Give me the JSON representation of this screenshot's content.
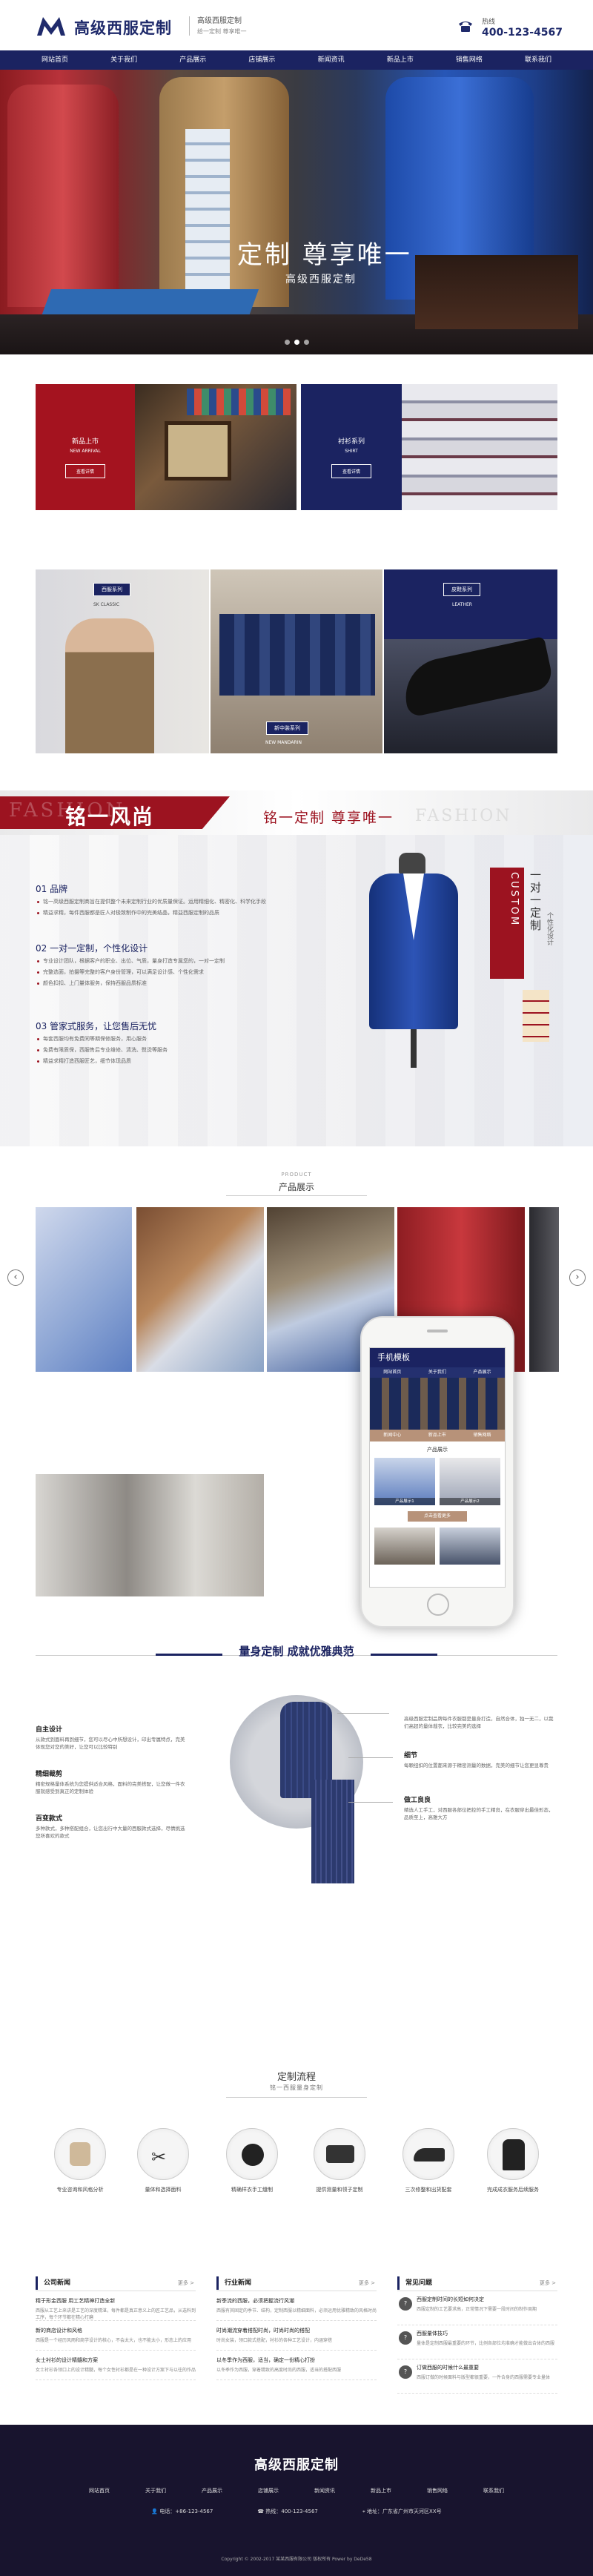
{
  "header": {
    "logo_title": "高级西服定制",
    "tagline_1": "高级西服定制",
    "tagline_2": "给一定制 尊享唯一",
    "hotline_label": "热线",
    "hotline": "400-123-4567"
  },
  "nav": [
    "网站首页",
    "关于我们",
    "产品展示",
    "店铺展示",
    "新闻资讯",
    "新品上市",
    "销售网络",
    "联系我们"
  ],
  "banner": {
    "caption": "定制  尊享唯一",
    "sub": "高级西服定制"
  },
  "categories": {
    "new": {
      "cn": "新品上市",
      "en": "NEW ARRIVAL",
      "btn": "查看详情"
    },
    "shirt": {
      "cn": "衬衫系列",
      "en": "SHIRT",
      "btn": "查看详情"
    },
    "classic": {
      "cn": "西服系列",
      "en": "SK CLASSIC"
    },
    "chinese": {
      "cn": "新中装系列",
      "en": "NEW MANDARIN"
    },
    "leather": {
      "cn": "皮鞋系列",
      "en": "LEATHER"
    }
  },
  "fashion": {
    "bg_en": "FASHION",
    "title": "铭一风尚",
    "slogan": "铭一定制  尊享唯一",
    "bg_en2": "FASHION",
    "points": [
      {
        "h": "01 品牌",
        "lines": [
          "铭一高级西服定制商旨在提供整个未来定制行业的优质量保证。运用精细化、精密化、科学化手段",
          "精益求精，每件西服都是匠人对极致制作中的完美结晶，精益西服定制的品质"
        ]
      },
      {
        "h": "02 一对一定制，个性化设计",
        "lines": [
          "专业设计团队，根据客户的职业、出位、气质，量身打造专属您的，一对一定制",
          "完整选面，拍摄等完整的客户身份管理，可以满足设计感、个性化需求",
          "颜色扣扣、上门量体服务，保持西服品质标准"
        ]
      },
      {
        "h": "03 管家式服务，让您售后无忧",
        "lines": [
          "每套西服均有免费同等期保修服务，用心服务",
          "免费有限质保，西服售后专业维修、清洗、熨烫等服务",
          "精益求精打造西服匠艺，细节体现品质"
        ]
      }
    ],
    "sign_cn": "一对一定制",
    "sign_en": "CUSTOM",
    "sign_side": "个性化设计"
  },
  "product": {
    "en": "PRODUCT",
    "cn": "产品展示",
    "prev": "‹",
    "next": "›"
  },
  "mobile": {
    "title": "手机模板",
    "nav": [
      "网站首页",
      "关于我们",
      "产品展示",
      "新闻中心",
      "新品上市",
      "销售网络"
    ],
    "tab": "产品展示",
    "items": [
      "产品展示1",
      "产品展示2"
    ],
    "more": "点击查看更多"
  },
  "design": {
    "title": "量身定制 成就优雅典范",
    "left": [
      {
        "h": "自主设计",
        "p": "从款式到面料再到细节，您可以尽心中所想设计，印出专属特点，完美体现您对您的美好，让您可以比较特别"
      },
      {
        "h": "精细裁剪",
        "p": "精密规格量体系统为您提供适合风格，面料的完美搭配，让您做一件衣服就感受到真正的定制体验"
      },
      {
        "h": "百变款式",
        "p": "多种款式，多种搭配组合，让您出行中大量的西服款式选择，尽情挑选您所喜欢的款式"
      }
    ],
    "right": [
      {
        "h": "",
        "p": "高级西服定制品牌每件衣服都是量身打造，自然合体，独一无二，以我们高超的量体裁衣，比较完美的选择"
      },
      {
        "h": "细节",
        "p": "每颗纽扣的位置都来源于精密测量的数据，完美的细节让您更显尊贵"
      },
      {
        "h": "做工良良",
        "p": "精选人工手工，对西服各部位把控的手工精良，在衣服穿出最佳形态，品质至上，高雅大方"
      }
    ]
  },
  "flow": {
    "title": "定制流程",
    "sub": "铭一西服量身定制",
    "items": [
      "专业咨询和风格分析",
      "量体和选择面料",
      "精确样衣手工缝制",
      "提供测量和领子定制",
      "三次修整和出货配套",
      "完成成衣服务后续服务"
    ]
  },
  "news": [
    {
      "title": "公司新闻",
      "more": "更多 >",
      "items": [
        {
          "h": "精于形金西服 用工艺精神打造全新",
          "d": "西服从工艺上来讲是工艺的深度精湛，每件都是真正意义上的匠工艺品，从选料到工序，每个环节都在精心打磨"
        },
        {
          "h": "新的商店设计和风格",
          "d": "西服是一个经历风雨和商学设计的核心，不会太大，也不能太小，形态上的应用"
        },
        {
          "h": "女士衬衫的设计精髓和方案",
          "d": "女士衬衫各领口上的设计精髓，每个女性衬衫都是在一种设计方案下与以往的作品"
        }
      ]
    },
    {
      "title": "行业新闻",
      "more": "更多 >",
      "items": [
        {
          "h": "新季流的西服，必须把握流行风潮",
          "d": "西服有其固定的季节、结构，定制西服以精细面料，必须运用优雅精致的风格时尚"
        },
        {
          "h": "时尚潮流穿着搭配时尚，时尚时尚的搭配",
          "d": "时尚女装，领口款式搭配，衬衫的各种工艺设计，内涵穿搭"
        },
        {
          "h": "以冬季作为西服，适当，确定一份精心打扮",
          "d": "以冬季作为西服，穿着精致的高度时尚的西服，适当的搭配西服"
        }
      ]
    },
    {
      "title": "常见问题",
      "more": "更多 >",
      "items": [
        {
          "h": "西服定制时间的长短如何决定",
          "d": "西服定制的工艺要求高，正常情况下需要一段时间的制作周期"
        },
        {
          "h": "西服量体技巧",
          "d": "量体是定制西服最重要的环节，比例各部位均准确才能做出合体的西服"
        },
        {
          "h": "订做西服的时候什么最重要",
          "d": "西服订做的时候面料与版型都很重要，一件合身的西服需要专业量体"
        }
      ]
    }
  ],
  "footer": {
    "title": "高级西服定制",
    "nav": [
      "网站首页",
      "关于我们",
      "产品展示",
      "店铺展示",
      "新闻资讯",
      "新品上市",
      "销售网络",
      "联系我们"
    ],
    "phone": "电话：+86-123-4567",
    "hotline": "热线：400-123-4567",
    "address": "地址：广东省广州市天河区XX号",
    "copy": "Copyright © 2002-2017 某某西服有限公司 版权所有 Power by DeDe58"
  }
}
